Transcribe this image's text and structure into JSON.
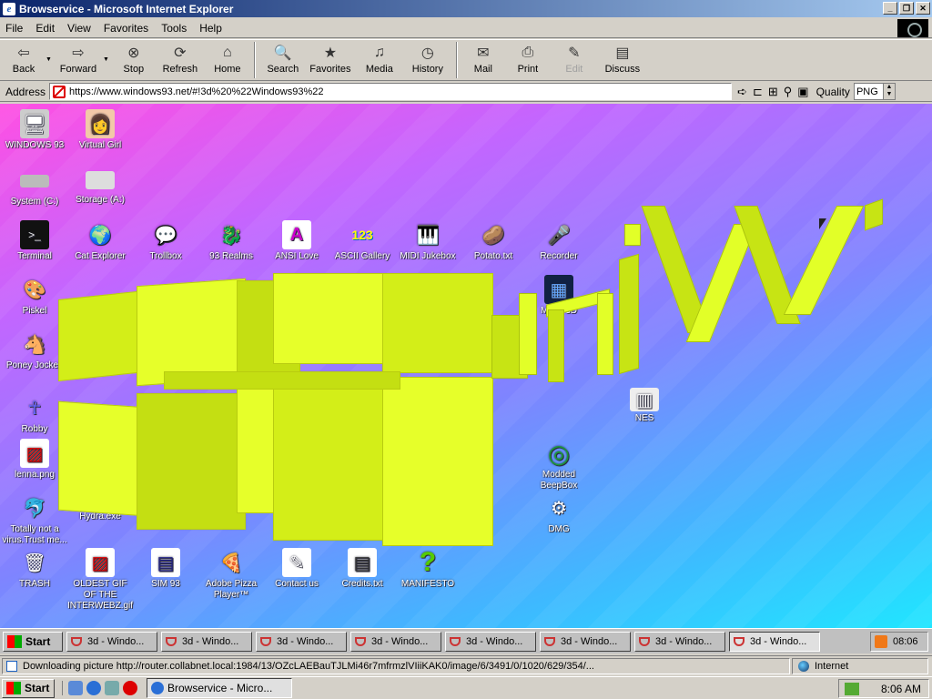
{
  "window": {
    "title": "Browservice - Microsoft Internet Explorer",
    "controls": [
      "_",
      "❐",
      "✕"
    ]
  },
  "menu": [
    "File",
    "Edit",
    "View",
    "Favorites",
    "Tools",
    "Help"
  ],
  "toolbar": {
    "back": "Back",
    "forward": "Forward",
    "stop": "Stop",
    "refresh": "Refresh",
    "home": "Home",
    "search": "Search",
    "favorites": "Favorites",
    "media": "Media",
    "history": "History",
    "mail": "Mail",
    "print": "Print",
    "edit": "Edit",
    "discuss": "Discuss"
  },
  "address": {
    "label": "Address",
    "url": "https://www.windows93.net/#!3d%20%22Windows93%22",
    "quality_label": "Quality",
    "quality_value": "PNG"
  },
  "desktop": {
    "icons": [
      {
        "name": "WINDOWS 93",
        "glyph": "🖥"
      },
      {
        "name": "Virtual Girl",
        "glyph": "👩"
      },
      {
        "name": "System (C:)",
        "glyph": "▭"
      },
      {
        "name": "Storage (A:)",
        "glyph": "🖴"
      },
      {
        "name": "Terminal",
        "glyph": "▣"
      },
      {
        "name": "Cat Explorer",
        "glyph": "🌍"
      },
      {
        "name": "Trollbox",
        "glyph": "💬"
      },
      {
        "name": "93 Realms",
        "glyph": "🐉"
      },
      {
        "name": "ANSI Love",
        "glyph": "A"
      },
      {
        "name": "ASCII Gallery",
        "glyph": "123"
      },
      {
        "name": "MIDI Jukebox",
        "glyph": "🎹"
      },
      {
        "name": "Potato.txt",
        "glyph": "🥔"
      },
      {
        "name": "Recorder",
        "glyph": "🎤"
      },
      {
        "name": "Piskel",
        "glyph": "🎨"
      },
      {
        "name": "Maze 3D",
        "glyph": "▦"
      },
      {
        "name": "Poney Jockey",
        "glyph": "🐴"
      },
      {
        "name": "Robby",
        "glyph": "☥"
      },
      {
        "name": "NES",
        "glyph": "▥"
      },
      {
        "name": "lenna.png",
        "glyph": "▨"
      },
      {
        "name": "Modded BeepBox",
        "glyph": "◎"
      },
      {
        "name": "Totally not a virus.Trust me...",
        "glyph": "🐬"
      },
      {
        "name": "Hydra.exe",
        "glyph": ""
      },
      {
        "name": "DMG",
        "glyph": "⚙"
      },
      {
        "name": "TRASH",
        "glyph": "🗑"
      },
      {
        "name": "OLDEST GIF OF THE INTERWEBZ.gif",
        "glyph": "▨"
      },
      {
        "name": "SIM 93",
        "glyph": "▤"
      },
      {
        "name": "Adobe Pizza Player™",
        "glyph": "🍕"
      },
      {
        "name": "Contact us",
        "glyph": "✎"
      },
      {
        "name": "Credits.txt",
        "glyph": "▤"
      },
      {
        "name": "MANIFESTO",
        "glyph": "?"
      }
    ]
  },
  "inner_taskbar": {
    "start": "Start",
    "items": [
      "3d - Windo...",
      "3d - Windo...",
      "3d - Windo...",
      "3d - Windo...",
      "3d - Windo...",
      "3d - Windo...",
      "3d - Windo...",
      "3d - Windo..."
    ],
    "clock": "08:06"
  },
  "status": {
    "text": "Downloading picture http://router.collabnet.local:1984/13/OZcLAEBauTJLMi46r7mfrmzlVIiiKAK0/image/6/3491/0/1020/629/354/...",
    "zone": "Internet"
  },
  "taskbar": {
    "start": "Start",
    "window_item": "Browservice - Micro...",
    "clock": "8:06 AM"
  }
}
